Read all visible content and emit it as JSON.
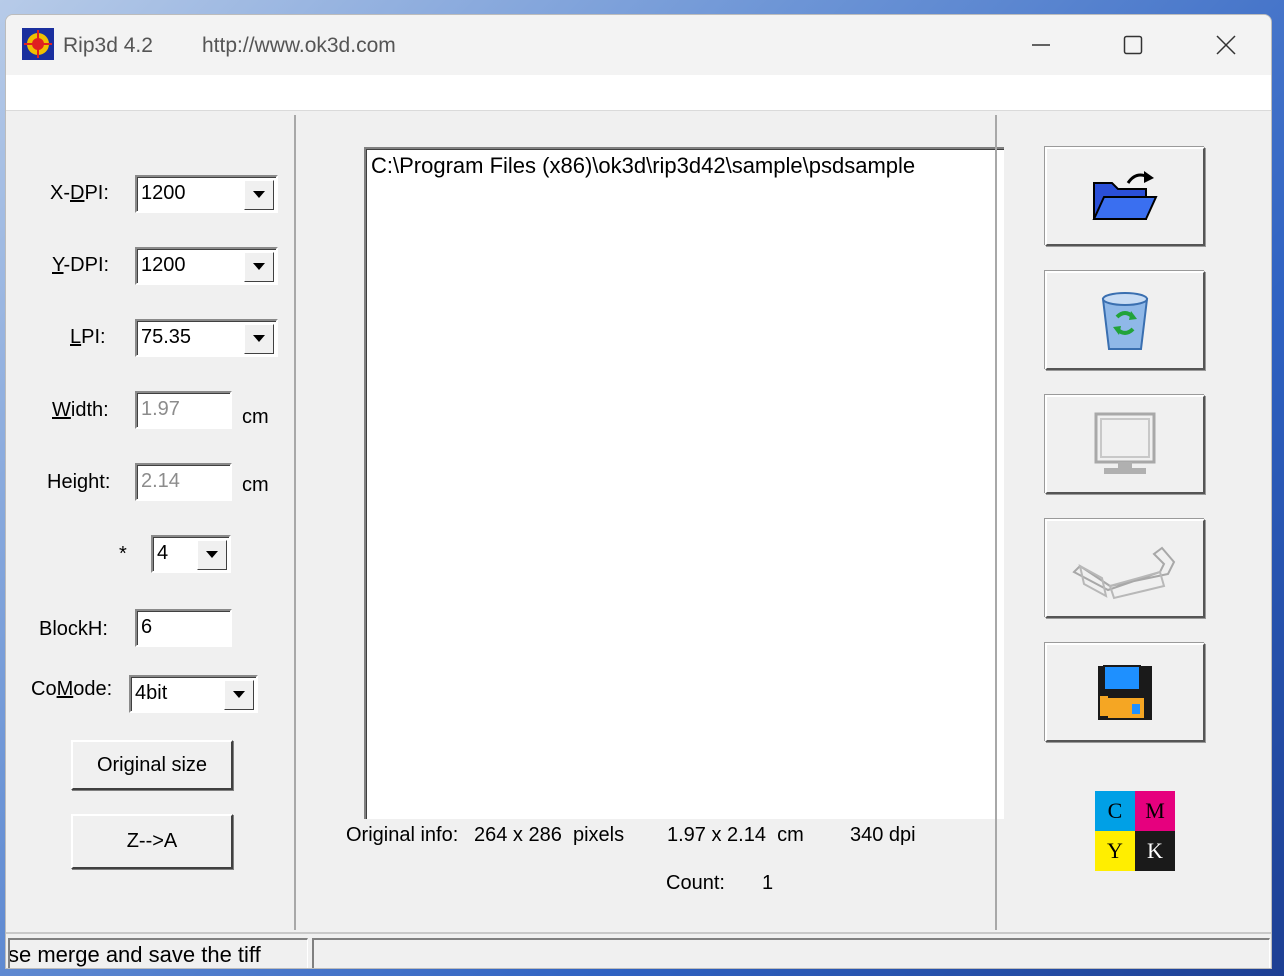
{
  "window": {
    "title": "Rip3d 4.2",
    "url": "http://www.ok3d.com"
  },
  "settings": {
    "xdpi": {
      "label_pre": "X-",
      "label_ul": "D",
      "label_post": "PI:",
      "value": "1200"
    },
    "ydpi": {
      "label_pre": "",
      "label_ul": "Y",
      "label_post": "-DPI:",
      "value": "1200"
    },
    "lpi": {
      "label_pre": "",
      "label_ul": "L",
      "label_post": "PI:",
      "value": "75.35"
    },
    "width": {
      "label_pre": "",
      "label_ul": "W",
      "label_post": "idth:",
      "value": "1.97",
      "unit": "cm"
    },
    "height": {
      "label": "Height:",
      "value": "2.14",
      "unit": "cm"
    },
    "multiplier": {
      "label": "*",
      "value": "4"
    },
    "blockh": {
      "label": "BlockH:",
      "value": "6"
    },
    "comode": {
      "label_pre": "Co",
      "label_ul": "M",
      "label_post": "ode:",
      "value": "4bit"
    },
    "original_size_label": "Original size",
    "sort_label": "Z-->A"
  },
  "file_list": {
    "items": [
      "C:\\Program Files (x86)\\ok3d\\rip3d42\\sample\\psdsample"
    ]
  },
  "info": {
    "original_info_label": "Original info:",
    "pixels": "264 x 286  pixels",
    "size": "1.97 x 2.14  cm",
    "dpi": "340 dpi",
    "count_label": "Count:",
    "count_value": "1"
  },
  "toolbar": {
    "icons": [
      "open-folder-icon",
      "recycle-bin-icon",
      "monitor-icon",
      "3d-glasses-icon",
      "floppy-disk-icon"
    ]
  },
  "cmyk": {
    "c": "C",
    "m": "M",
    "y": "Y",
    "k": "K",
    "colors": {
      "c": "#00a0e6",
      "m": "#e6007e",
      "y": "#ffee00",
      "k": "#1a1a1a"
    }
  },
  "status": {
    "message": "se merge and save the tiff",
    "second": ""
  }
}
